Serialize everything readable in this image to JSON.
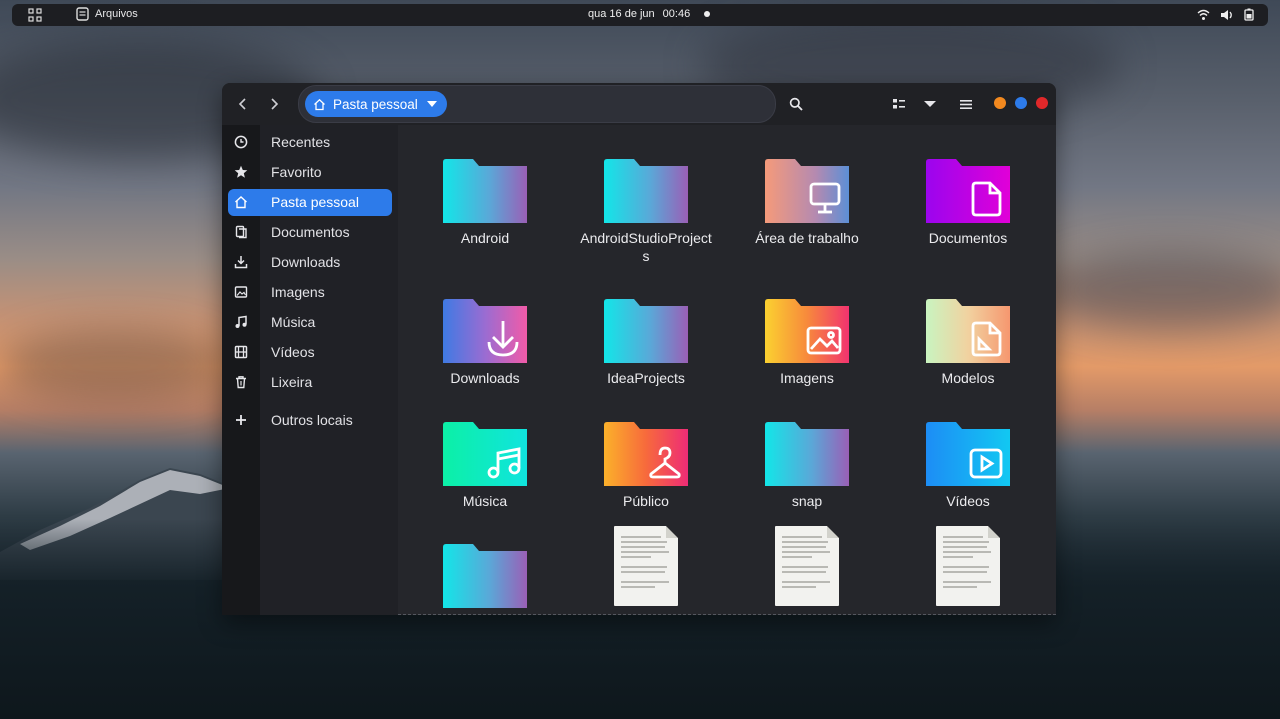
{
  "topbar": {
    "app_name": "Arquivos",
    "date": "qua 16 de jun",
    "time": "00:46"
  },
  "header": {
    "breadcrumb_label": "Pasta pessoal"
  },
  "sidebar": {
    "items": [
      {
        "label": "Recentes",
        "icon": "clock-icon"
      },
      {
        "label": "Favorito",
        "icon": "star-icon"
      },
      {
        "label": "Pasta pessoal",
        "icon": "home-icon",
        "active": true
      },
      {
        "label": "Documentos",
        "icon": "document-icon"
      },
      {
        "label": "Downloads",
        "icon": "download-icon"
      },
      {
        "label": "Imagens",
        "icon": "image-icon"
      },
      {
        "label": "Música",
        "icon": "music-icon"
      },
      {
        "label": "Vídeos",
        "icon": "film-icon"
      },
      {
        "label": "Lixeira",
        "icon": "trash-icon"
      },
      {
        "label": "Outros locais",
        "icon": "plus-icon"
      }
    ]
  },
  "files": [
    {
      "name": "Android",
      "kind": "folder",
      "emblem": ""
    },
    {
      "name": "AndroidStudioProjects",
      "kind": "folder",
      "emblem": ""
    },
    {
      "name": "Área de trabalho",
      "kind": "folder",
      "emblem": "desktop-icon"
    },
    {
      "name": "Documentos",
      "kind": "folder",
      "emblem": "document-icon"
    },
    {
      "name": "Downloads",
      "kind": "folder",
      "emblem": "download-icon"
    },
    {
      "name": "IdeaProjects",
      "kind": "folder",
      "emblem": ""
    },
    {
      "name": "Imagens",
      "kind": "folder",
      "emblem": "image-icon"
    },
    {
      "name": "Modelos",
      "kind": "folder",
      "emblem": "template-icon"
    },
    {
      "name": "Música",
      "kind": "folder",
      "emblem": "music-icon"
    },
    {
      "name": "Público",
      "kind": "folder",
      "emblem": "hanger-icon"
    },
    {
      "name": "snap",
      "kind": "folder",
      "emblem": ""
    },
    {
      "name": "Vídeos",
      "kind": "folder",
      "emblem": "play-icon"
    },
    {
      "name": "",
      "kind": "folder",
      "emblem": ""
    },
    {
      "name": "",
      "kind": "text-file",
      "emblem": "text-file-icon"
    },
    {
      "name": "",
      "kind": "text-file",
      "emblem": "text-file-icon"
    },
    {
      "name": "",
      "kind": "text-file",
      "emblem": "text-file-icon"
    }
  ],
  "colors": {
    "accent": "#2d7bea",
    "window_close": "#e0282a",
    "window_maximize": "#2d7bea",
    "window_minimize": "#f2891f"
  }
}
